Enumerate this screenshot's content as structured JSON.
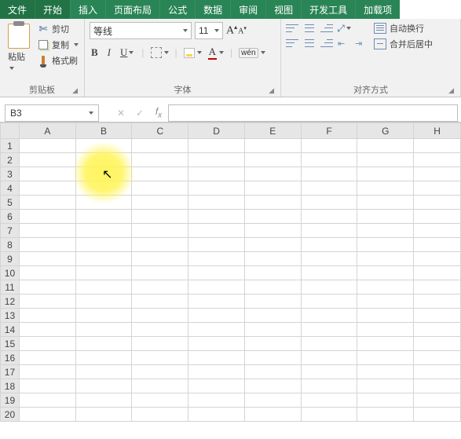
{
  "tabs": {
    "file": "文件",
    "home": "开始",
    "insert": "插入",
    "layout": "页面布局",
    "formulas": "公式",
    "data": "数据",
    "review": "审阅",
    "view": "视图",
    "dev": "开发工具",
    "addins": "加载项"
  },
  "clipboard": {
    "paste": "粘贴",
    "cut": "剪切",
    "copy": "复制",
    "format_painter": "格式刷",
    "title": "剪贴板"
  },
  "font": {
    "name": "等线",
    "size": "11",
    "title": "字体",
    "wen": "wén"
  },
  "align": {
    "wrap": "自动换行",
    "merge": "合并后居中",
    "title": "对齐方式"
  },
  "name_box": "B3",
  "columns": [
    "A",
    "B",
    "C",
    "D",
    "E",
    "F",
    "G",
    "H"
  ],
  "rows": [
    "1",
    "2",
    "3",
    "4",
    "5",
    "6",
    "7",
    "8",
    "9",
    "10",
    "11",
    "12",
    "13",
    "14",
    "15",
    "16",
    "17",
    "18",
    "19",
    "20"
  ]
}
